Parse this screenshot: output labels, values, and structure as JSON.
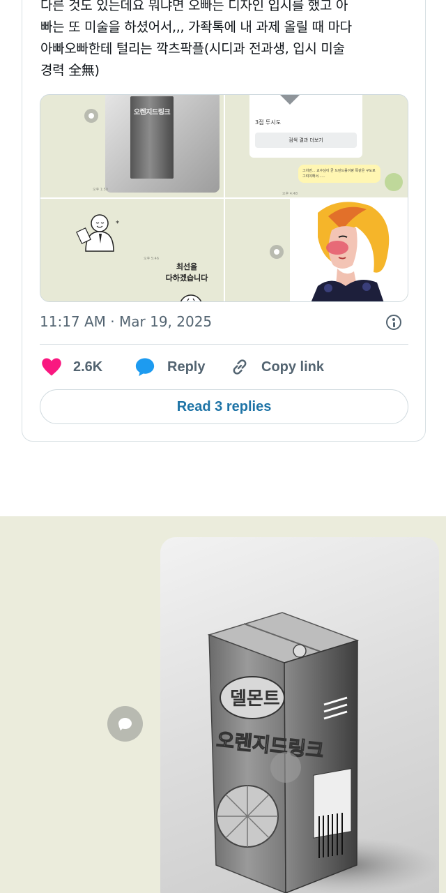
{
  "tweet": {
    "text_lines": [
      "다른 것도 있는데요 뭐냐면 오빠는 디자인 입시를 했고 아",
      "빠는 또 미술을 하셨어서,,, 가좍톡에 내 과제 올릴 때 마다",
      "아빠오빠한테 털리는 깍츠팍플(시디과 전과생, 입시 미술",
      "경력 全無)"
    ],
    "timestamp": "11:17 AM · Mar 19, 2025"
  },
  "media": {
    "carton_label": "오렌지드링크",
    "chat_question": "3점 투시도",
    "chat_button": "검색 결과 더보기",
    "chat_reply": "그치만... 교수님이 곧 드린드롤이랑 똑같은 구도로 그려야해서......",
    "doodle_text_line1": "최선을",
    "doodle_text_line2": "다하겠습니다",
    "tile_time": "오후 1:50",
    "tile_time2": "오후 4:48",
    "tile_time3": "오후 5:46"
  },
  "actions": {
    "like_count": "2.6K",
    "reply_label": "Reply",
    "copy_label": "Copy link",
    "read_replies": "Read 3 replies"
  },
  "colors": {
    "like": "#f91880",
    "reply": "#1d9bf0",
    "link_blue": "#1d73a6",
    "panel_bg": "#ebecdc"
  },
  "icons": [
    "heart-icon",
    "reply-bubble-icon",
    "link-icon",
    "info-icon",
    "chat-indicator-icon"
  ]
}
